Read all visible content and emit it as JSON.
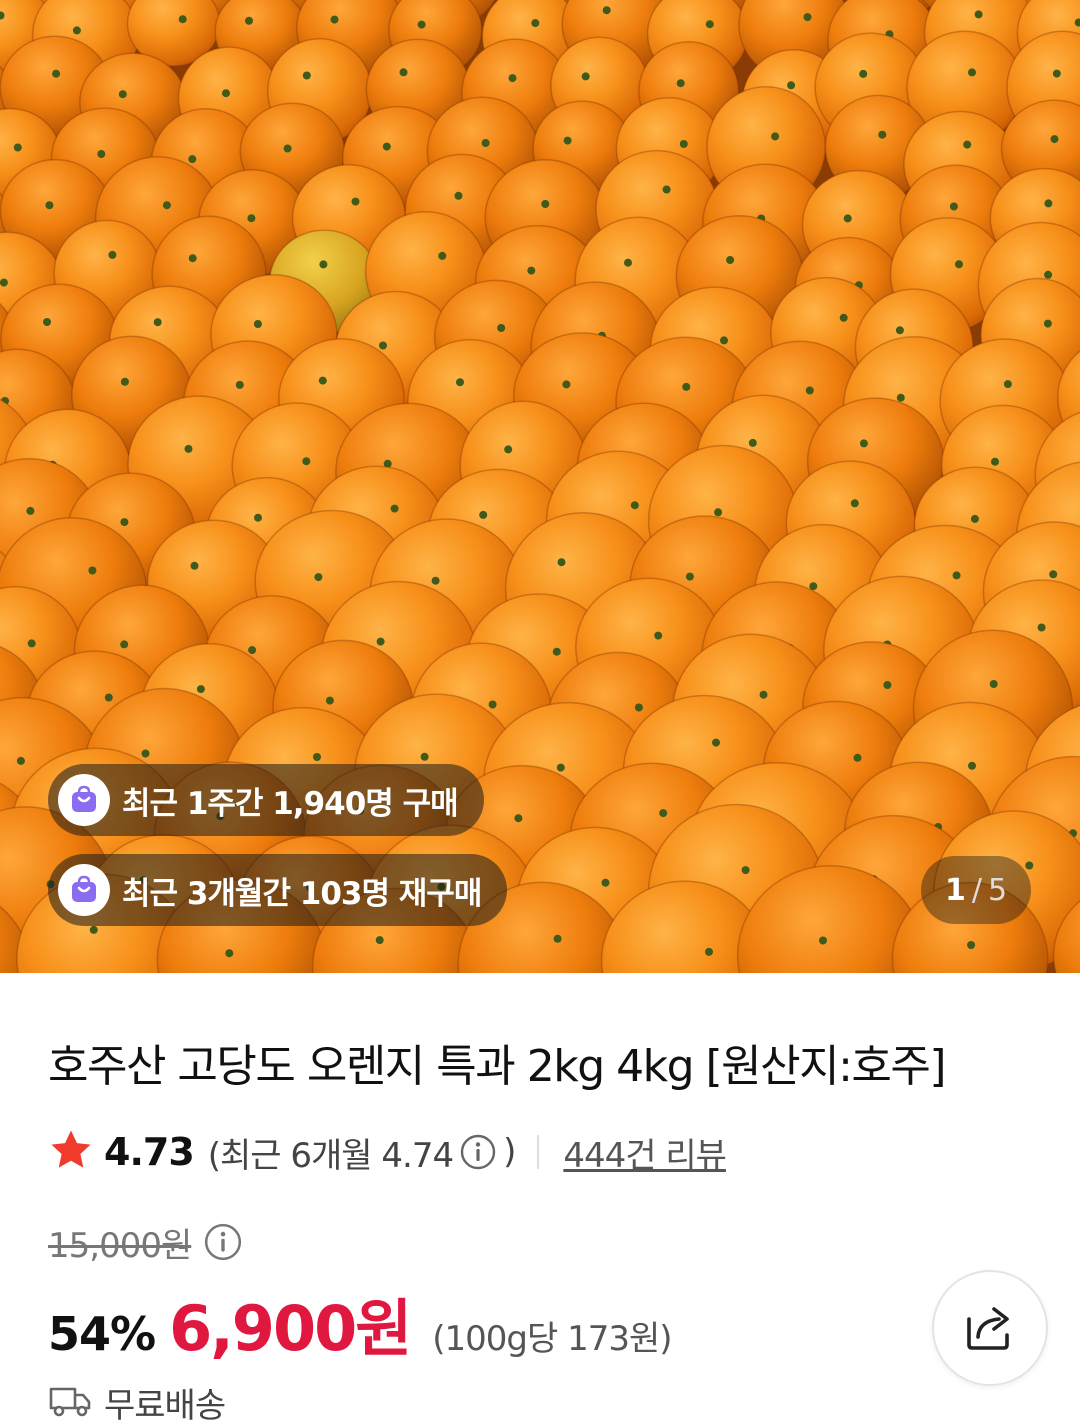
{
  "hero": {
    "badges": [
      {
        "icon": "shopping-bag-icon",
        "text": "최근 1주간 1,940명 구매"
      },
      {
        "icon": "shopping-bag-icon",
        "text": "최근 3개월간 103명 재구매"
      }
    ],
    "pager": {
      "current": "1",
      "separator": "/",
      "total": "5"
    }
  },
  "product": {
    "title": "호주산 고당도 오렌지 특과 2kg 4kg [원산지:호주]",
    "rating": {
      "icon": "star-icon",
      "score": "4.73",
      "recent_open": "(최근 6개월 4.74",
      "recent_close": ")",
      "review_link": "444건 리뷰"
    },
    "price": {
      "original": "15,000원",
      "discount": "54%",
      "sale": "6,900원",
      "unit": "(100g당 173원)"
    },
    "shipping": {
      "icon": "truck-icon",
      "label": "무료배송"
    },
    "share": {
      "icon": "share-icon"
    }
  },
  "colors": {
    "accent_red": "#e0173f",
    "star": "#f03a2c",
    "badge_icon": "#8b6cf0"
  }
}
